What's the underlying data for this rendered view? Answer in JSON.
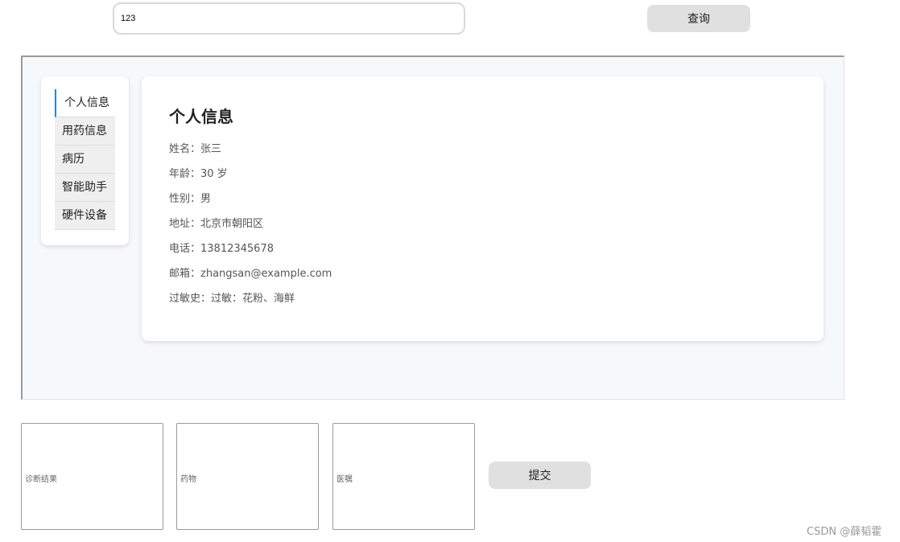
{
  "search": {
    "value": "123",
    "button_label": "查询"
  },
  "sidebar": {
    "items": [
      {
        "label": "个人信息",
        "active": true
      },
      {
        "label": "用药信息",
        "active": false
      },
      {
        "label": "病历",
        "active": false
      },
      {
        "label": "智能助手",
        "active": false
      },
      {
        "label": "硬件设备",
        "active": false
      }
    ]
  },
  "profile": {
    "title": "个人信息",
    "name": "姓名：张三",
    "age": "年龄：30 岁",
    "gender": "性别：男",
    "address": "地址：北京市朝阳区",
    "phone": "电话：13812345678",
    "email": "邮箱：zhangsan@example.com",
    "allergy": "过敏史：过敏：花粉、海鲜"
  },
  "form": {
    "diagnosis_placeholder": "诊断结果",
    "medication_placeholder": "药物",
    "advice_placeholder": "医嘱",
    "submit_label": "提交"
  },
  "watermark": "CSDN @薛韬霍",
  "colors": {
    "accent": "#1e88e5",
    "button_bg": "#e0e0e0",
    "panel_bg": "#f7f8fa"
  }
}
